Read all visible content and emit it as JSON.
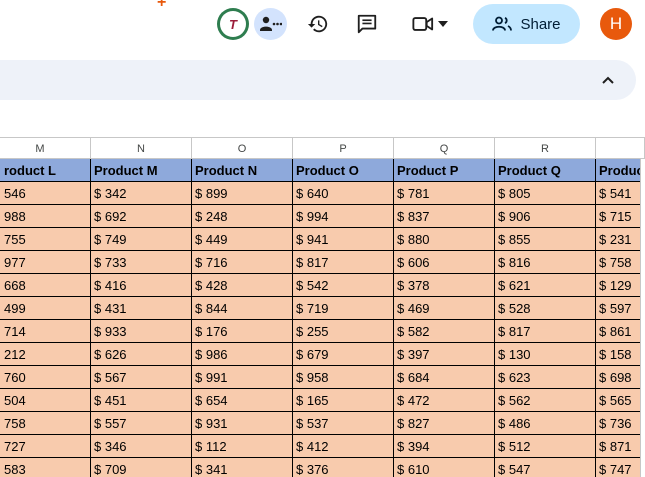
{
  "toolbar": {
    "avatar_logo_text": "T",
    "share_label": "Share",
    "user_initial": "H"
  },
  "sheet": {
    "column_letters": [
      "M",
      "N",
      "O",
      "P",
      "Q",
      "R",
      ""
    ],
    "header_row": [
      "roduct L",
      "Product M",
      "Product N",
      "Product O",
      "Product P",
      "Product Q",
      "Produc"
    ],
    "rows": [
      [
        "546",
        "$ 342",
        "$ 899",
        "$ 640",
        "$ 781",
        "$ 805",
        "$ 541"
      ],
      [
        "988",
        "$ 692",
        "$ 248",
        "$ 994",
        "$ 837",
        "$ 906",
        "$ 715"
      ],
      [
        "755",
        "$ 749",
        "$ 449",
        "$ 941",
        "$ 880",
        "$ 855",
        "$ 231"
      ],
      [
        "977",
        "$ 733",
        "$ 716",
        "$ 817",
        "$ 606",
        "$ 816",
        "$ 758"
      ],
      [
        "668",
        "$ 416",
        "$ 428",
        "$ 542",
        "$ 378",
        "$ 621",
        "$ 129"
      ],
      [
        "499",
        "$ 431",
        "$ 844",
        "$ 719",
        "$ 469",
        "$ 528",
        "$ 597"
      ],
      [
        "714",
        "$ 933",
        "$ 176",
        "$ 255",
        "$ 582",
        "$ 817",
        "$ 861"
      ],
      [
        "212",
        "$ 626",
        "$ 986",
        "$ 679",
        "$ 397",
        "$ 130",
        "$ 158"
      ],
      [
        "760",
        "$ 567",
        "$ 991",
        "$ 958",
        "$ 684",
        "$ 623",
        "$ 698"
      ],
      [
        "504",
        "$ 451",
        "$ 654",
        "$ 165",
        "$ 472",
        "$ 562",
        "$ 565"
      ],
      [
        "758",
        "$ 557",
        "$ 931",
        "$ 537",
        "$ 827",
        "$ 486",
        "$ 736"
      ],
      [
        "727",
        "$ 346",
        "$ 112",
        "$ 412",
        "$ 394",
        "$ 512",
        "$ 871"
      ],
      [
        "583",
        "$ 709",
        "$ 341",
        "$ 376",
        "$ 610",
        "$ 547",
        "$ 747"
      ]
    ]
  },
  "colors": {
    "header_fill": "#8ea9db",
    "body_fill": "#f8cbad",
    "share_button": "#c2e7ff",
    "user_avatar": "#e8590c"
  },
  "icons": {
    "chat": "chat-people-icon",
    "history": "history-icon",
    "comment": "comment-icon",
    "meet": "video-camera-icon",
    "share": "people-icon",
    "collapse": "chevron-up-icon"
  }
}
